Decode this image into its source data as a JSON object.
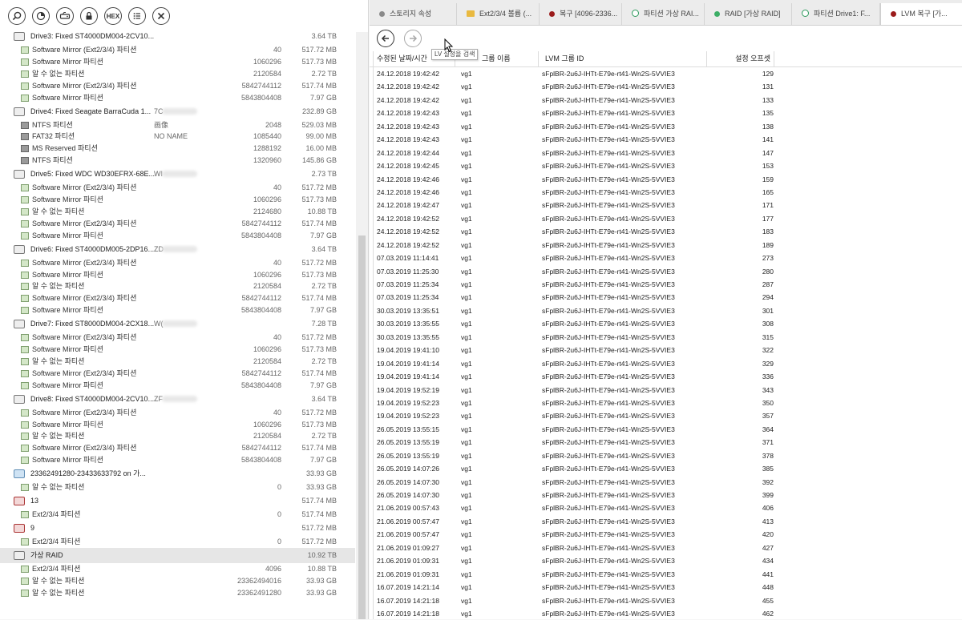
{
  "toolbar": [
    {
      "name": "search-icon"
    },
    {
      "name": "scan-icon"
    },
    {
      "name": "drive-link-icon"
    },
    {
      "name": "lock-icon"
    },
    {
      "name": "hex-icon",
      "label": "HEX"
    },
    {
      "name": "list-icon"
    },
    {
      "name": "close-icon"
    }
  ],
  "tree": [
    {
      "t": "drive",
      "name": "Drive3: Fixed ST4000DM004-2CV10...",
      "size": "3.64 TB",
      "ic": "vr"
    },
    {
      "t": "child",
      "name": "Software Mirror (Ext2/3/4) 파티션",
      "off": "40",
      "size": "517.72 MB",
      "ic": "gr"
    },
    {
      "t": "child",
      "name": "Software Mirror 파티션",
      "off": "1060296",
      "size": "517.73 MB",
      "ic": "gr"
    },
    {
      "t": "child",
      "name": "알 수 없는 파티션",
      "off": "2120584",
      "size": "2.72 TB",
      "ic": "gr"
    },
    {
      "t": "child",
      "name": "Software Mirror (Ext2/3/4) 파티션",
      "off": "5842744112",
      "size": "517.74 MB",
      "ic": "gr"
    },
    {
      "t": "child",
      "name": "Software Mirror 파티션",
      "off": "5843804408",
      "size": "7.97 GB",
      "ic": "gr"
    },
    {
      "t": "drive",
      "name": "Drive4: Fixed Seagate BarraCuda 1...",
      "serial": "7C",
      "size": "232.89 GB",
      "ic": "vr"
    },
    {
      "t": "child",
      "name": "NTFS 파티션",
      "extra": "画像",
      "off": "2048",
      "size": "529.03 MB",
      "ic": "blk"
    },
    {
      "t": "child",
      "name": "FAT32 파티션",
      "extra": "NO NAME",
      "off": "1085440",
      "size": "99.00 MB",
      "ic": "blk"
    },
    {
      "t": "child",
      "name": "MS Reserved 파티션",
      "off": "1288192",
      "size": "16.00 MB",
      "ic": "blk"
    },
    {
      "t": "child",
      "name": "NTFS 파티션",
      "off": "1320960",
      "size": "145.86 GB",
      "ic": "blk"
    },
    {
      "t": "drive",
      "name": "Drive5: Fixed WDC WD30EFRX-68E...",
      "serial": "WI",
      "size": "2.73 TB",
      "ic": "vr"
    },
    {
      "t": "child",
      "name": "Software Mirror (Ext2/3/4) 파티션",
      "off": "40",
      "size": "517.72 MB",
      "ic": "gr"
    },
    {
      "t": "child",
      "name": "Software Mirror 파티션",
      "off": "1060296",
      "size": "517.73 MB",
      "ic": "gr"
    },
    {
      "t": "child",
      "name": "알 수 없는 파티션",
      "off": "2124680",
      "size": "10.88 TB",
      "ic": "gr"
    },
    {
      "t": "child",
      "name": "Software Mirror (Ext2/3/4) 파티션",
      "off": "5842744112",
      "size": "517.74 MB",
      "ic": "gr"
    },
    {
      "t": "child",
      "name": "Software Mirror 파티션",
      "off": "5843804408",
      "size": "7.97 GB",
      "ic": "gr"
    },
    {
      "t": "drive",
      "name": "Drive6: Fixed ST4000DM005-2DP16...",
      "serial": "ZD",
      "size": "3.64 TB",
      "ic": "vr"
    },
    {
      "t": "child",
      "name": "Software Mirror (Ext2/3/4) 파티션",
      "off": "40",
      "size": "517.72 MB",
      "ic": "gr"
    },
    {
      "t": "child",
      "name": "Software Mirror 파티션",
      "off": "1060296",
      "size": "517.73 MB",
      "ic": "gr"
    },
    {
      "t": "child",
      "name": "알 수 없는 파티션",
      "off": "2120584",
      "size": "2.72 TB",
      "ic": "gr"
    },
    {
      "t": "child",
      "name": "Software Mirror (Ext2/3/4) 파티션",
      "off": "5842744112",
      "size": "517.74 MB",
      "ic": "gr"
    },
    {
      "t": "child",
      "name": "Software Mirror 파티션",
      "off": "5843804408",
      "size": "7.97 GB",
      "ic": "gr"
    },
    {
      "t": "drive",
      "name": "Drive7: Fixed ST8000DM004-2CX18...",
      "serial": "W(",
      "size": "7.28 TB",
      "ic": "vr"
    },
    {
      "t": "child",
      "name": "Software Mirror (Ext2/3/4) 파티션",
      "off": "40",
      "size": "517.72 MB",
      "ic": "gr"
    },
    {
      "t": "child",
      "name": "Software Mirror 파티션",
      "off": "1060296",
      "size": "517.73 MB",
      "ic": "gr"
    },
    {
      "t": "child",
      "name": "알 수 없는 파티션",
      "off": "2120584",
      "size": "2.72 TB",
      "ic": "gr"
    },
    {
      "t": "child",
      "name": "Software Mirror (Ext2/3/4) 파티션",
      "off": "5842744112",
      "size": "517.74 MB",
      "ic": "gr"
    },
    {
      "t": "child",
      "name": "Software Mirror 파티션",
      "off": "5843804408",
      "size": "7.97 GB",
      "ic": "gr"
    },
    {
      "t": "drive",
      "name": "Drive8: Fixed ST4000DM004-2CV10...",
      "serial": "ZF",
      "size": "3.64 TB",
      "ic": "vr"
    },
    {
      "t": "child",
      "name": "Software Mirror (Ext2/3/4) 파티션",
      "off": "40",
      "size": "517.72 MB",
      "ic": "gr"
    },
    {
      "t": "child",
      "name": "Software Mirror 파티션",
      "off": "1060296",
      "size": "517.73 MB",
      "ic": "gr"
    },
    {
      "t": "child",
      "name": "알 수 없는 파티션",
      "off": "2120584",
      "size": "2.72 TB",
      "ic": "gr"
    },
    {
      "t": "child",
      "name": "Software Mirror (Ext2/3/4) 파티션",
      "off": "5842744112",
      "size": "517.74 MB",
      "ic": "gr"
    },
    {
      "t": "child",
      "name": "Software Mirror 파티션",
      "off": "5843804408",
      "size": "7.97 GB",
      "ic": "gr"
    },
    {
      "t": "drive",
      "name": "23362491280-23433633792 on 가...",
      "size": "33.93 GB",
      "ic": "img"
    },
    {
      "t": "child",
      "name": "알 수 없는 파티션",
      "off": "0",
      "size": "33.93 GB",
      "ic": "gr"
    },
    {
      "t": "drive",
      "name": "13",
      "size": "517.74 MB",
      "ic": "rd"
    },
    {
      "t": "child",
      "name": "Ext2/3/4 파티션",
      "off": "0",
      "size": "517.74 MB",
      "ic": "gr"
    },
    {
      "t": "drive",
      "name": "9",
      "size": "517.72 MB",
      "ic": "rd"
    },
    {
      "t": "child",
      "name": "Ext2/3/4 파티션",
      "off": "0",
      "size": "517.72 MB",
      "ic": "gr"
    },
    {
      "t": "drive",
      "name": "가상 RAID",
      "size": "10.92 TB",
      "ic": "vr",
      "sel": true
    },
    {
      "t": "child",
      "name": "Ext2/3/4 파티션",
      "off": "4096",
      "size": "10.88 TB",
      "ic": "gr"
    },
    {
      "t": "child",
      "name": "알 수 없는 파티션",
      "off": "23362494016",
      "size": "33.93 GB",
      "ic": "gr"
    },
    {
      "t": "child",
      "name": "알 수 없는 파티션",
      "off": "23362491280",
      "size": "33.93 GB",
      "ic": "gr"
    }
  ],
  "tabs": [
    {
      "label": "스토리지 속성",
      "icon": "grey"
    },
    {
      "label": "Ext2/3/4 볼륨 (...",
      "icon": "folder"
    },
    {
      "label": "복구 [4096-2336...",
      "icon": "red"
    },
    {
      "label": "파티션 가상 RAI...",
      "icon": "ring"
    },
    {
      "label": "RAID [가상 RAID]",
      "icon": "green"
    },
    {
      "label": "파티션 Drive1: F...",
      "icon": "ring"
    },
    {
      "label": "LVM 복구 [가...",
      "icon": "red",
      "active": true
    }
  ],
  "tooltip": "LV 설정을 검색",
  "columns": {
    "date": "수정된 날짜/시간",
    "group": "그룹 이름",
    "id": "LVM 그룹 ID",
    "offset": "설정 오프셋"
  },
  "rows": [
    [
      "24.12.2018 19:42:42",
      "vg1",
      "sFplBR-2u6J-IHTt-E79e-rt41-Wn2S-5VVIE3",
      "129"
    ],
    [
      "24.12.2018 19:42:42",
      "vg1",
      "sFplBR-2u6J-IHTt-E79e-rt41-Wn2S-5VVIE3",
      "131"
    ],
    [
      "24.12.2018 19:42:42",
      "vg1",
      "sFplBR-2u6J-IHTt-E79e-rt41-Wn2S-5VVIE3",
      "133"
    ],
    [
      "24.12.2018 19:42:43",
      "vg1",
      "sFplBR-2u6J-IHTt-E79e-rt41-Wn2S-5VVIE3",
      "135"
    ],
    [
      "24.12.2018 19:42:43",
      "vg1",
      "sFplBR-2u6J-IHTt-E79e-rt41-Wn2S-5VVIE3",
      "138"
    ],
    [
      "24.12.2018 19:42:43",
      "vg1",
      "sFplBR-2u6J-IHTt-E79e-rt41-Wn2S-5VVIE3",
      "141"
    ],
    [
      "24.12.2018 19:42:44",
      "vg1",
      "sFplBR-2u6J-IHTt-E79e-rt41-Wn2S-5VVIE3",
      "147"
    ],
    [
      "24.12.2018 19:42:45",
      "vg1",
      "sFplBR-2u6J-IHTt-E79e-rt41-Wn2S-5VVIE3",
      "153"
    ],
    [
      "24.12.2018 19:42:46",
      "vg1",
      "sFplBR-2u6J-IHTt-E79e-rt41-Wn2S-5VVIE3",
      "159"
    ],
    [
      "24.12.2018 19:42:46",
      "vg1",
      "sFplBR-2u6J-IHTt-E79e-rt41-Wn2S-5VVIE3",
      "165"
    ],
    [
      "24.12.2018 19:42:47",
      "vg1",
      "sFplBR-2u6J-IHTt-E79e-rt41-Wn2S-5VVIE3",
      "171"
    ],
    [
      "24.12.2018 19:42:52",
      "vg1",
      "sFplBR-2u6J-IHTt-E79e-rt41-Wn2S-5VVIE3",
      "177"
    ],
    [
      "24.12.2018 19:42:52",
      "vg1",
      "sFplBR-2u6J-IHTt-E79e-rt41-Wn2S-5VVIE3",
      "183"
    ],
    [
      "24.12.2018 19:42:52",
      "vg1",
      "sFplBR-2u6J-IHTt-E79e-rt41-Wn2S-5VVIE3",
      "189"
    ],
    [
      "07.03.2019 11:14:41",
      "vg1",
      "sFplBR-2u6J-IHTt-E79e-rt41-Wn2S-5VVIE3",
      "273"
    ],
    [
      "07.03.2019 11:25:30",
      "vg1",
      "sFplBR-2u6J-IHTt-E79e-rt41-Wn2S-5VVIE3",
      "280"
    ],
    [
      "07.03.2019 11:25:34",
      "vg1",
      "sFplBR-2u6J-IHTt-E79e-rt41-Wn2S-5VVIE3",
      "287"
    ],
    [
      "07.03.2019 11:25:34",
      "vg1",
      "sFplBR-2u6J-IHTt-E79e-rt41-Wn2S-5VVIE3",
      "294"
    ],
    [
      "30.03.2019 13:35:51",
      "vg1",
      "sFplBR-2u6J-IHTt-E79e-rt41-Wn2S-5VVIE3",
      "301"
    ],
    [
      "30.03.2019 13:35:55",
      "vg1",
      "sFplBR-2u6J-IHTt-E79e-rt41-Wn2S-5VVIE3",
      "308"
    ],
    [
      "30.03.2019 13:35:55",
      "vg1",
      "sFplBR-2u6J-IHTt-E79e-rt41-Wn2S-5VVIE3",
      "315"
    ],
    [
      "19.04.2019 19:41:10",
      "vg1",
      "sFplBR-2u6J-IHTt-E79e-rt41-Wn2S-5VVIE3",
      "322"
    ],
    [
      "19.04.2019 19:41:14",
      "vg1",
      "sFplBR-2u6J-IHTt-E79e-rt41-Wn2S-5VVIE3",
      "329"
    ],
    [
      "19.04.2019 19:41:14",
      "vg1",
      "sFplBR-2u6J-IHTt-E79e-rt41-Wn2S-5VVIE3",
      "336"
    ],
    [
      "19.04.2019 19:52:19",
      "vg1",
      "sFplBR-2u6J-IHTt-E79e-rt41-Wn2S-5VVIE3",
      "343"
    ],
    [
      "19.04.2019 19:52:23",
      "vg1",
      "sFplBR-2u6J-IHTt-E79e-rt41-Wn2S-5VVIE3",
      "350"
    ],
    [
      "19.04.2019 19:52:23",
      "vg1",
      "sFplBR-2u6J-IHTt-E79e-rt41-Wn2S-5VVIE3",
      "357"
    ],
    [
      "26.05.2019 13:55:15",
      "vg1",
      "sFplBR-2u6J-IHTt-E79e-rt41-Wn2S-5VVIE3",
      "364"
    ],
    [
      "26.05.2019 13:55:19",
      "vg1",
      "sFplBR-2u6J-IHTt-E79e-rt41-Wn2S-5VVIE3",
      "371"
    ],
    [
      "26.05.2019 13:55:19",
      "vg1",
      "sFplBR-2u6J-IHTt-E79e-rt41-Wn2S-5VVIE3",
      "378"
    ],
    [
      "26.05.2019 14:07:26",
      "vg1",
      "sFplBR-2u6J-IHTt-E79e-rt41-Wn2S-5VVIE3",
      "385"
    ],
    [
      "26.05.2019 14:07:30",
      "vg1",
      "sFplBR-2u6J-IHTt-E79e-rt41-Wn2S-5VVIE3",
      "392"
    ],
    [
      "26.05.2019 14:07:30",
      "vg1",
      "sFplBR-2u6J-IHTt-E79e-rt41-Wn2S-5VVIE3",
      "399"
    ],
    [
      "21.06.2019 00:57:43",
      "vg1",
      "sFplBR-2u6J-IHTt-E79e-rt41-Wn2S-5VVIE3",
      "406"
    ],
    [
      "21.06.2019 00:57:47",
      "vg1",
      "sFplBR-2u6J-IHTt-E79e-rt41-Wn2S-5VVIE3",
      "413"
    ],
    [
      "21.06.2019 00:57:47",
      "vg1",
      "sFplBR-2u6J-IHTt-E79e-rt41-Wn2S-5VVIE3",
      "420"
    ],
    [
      "21.06.2019 01:09:27",
      "vg1",
      "sFplBR-2u6J-IHTt-E79e-rt41-Wn2S-5VVIE3",
      "427"
    ],
    [
      "21.06.2019 01:09:31",
      "vg1",
      "sFplBR-2u6J-IHTt-E79e-rt41-Wn2S-5VVIE3",
      "434"
    ],
    [
      "21.06.2019 01:09:31",
      "vg1",
      "sFplBR-2u6J-IHTt-E79e-rt41-Wn2S-5VVIE3",
      "441"
    ],
    [
      "16.07.2019 14:21:14",
      "vg1",
      "sFplBR-2u6J-IHTt-E79e-rt41-Wn2S-5VVIE3",
      "448"
    ],
    [
      "16.07.2019 14:21:18",
      "vg1",
      "sFplBR-2u6J-IHTt-E79e-rt41-Wn2S-5VVIE3",
      "455"
    ],
    [
      "16.07.2019 14:21:18",
      "vg1",
      "sFplBR-2u6J-IHTt-E79e-rt41-Wn2S-5VVIE3",
      "462"
    ]
  ]
}
